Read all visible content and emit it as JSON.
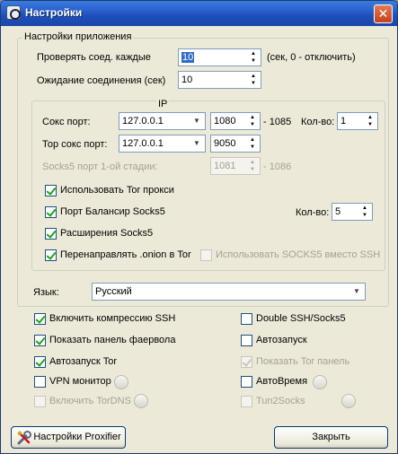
{
  "window": {
    "title": "Настройки"
  },
  "app_group": {
    "legend": "Настройки приложения"
  },
  "check_conn": {
    "label": "Проверять соед. каждые",
    "value": "10",
    "hint": "(сек, 0 - отключить)"
  },
  "wait_conn": {
    "label": "Ожидание соединения (сек)",
    "value": "10"
  },
  "ip_group": {
    "legend": "IP",
    "socks_port": {
      "label": "Сокс порт:",
      "ip": "127.0.0.1",
      "port": "1080",
      "range": "- 1085",
      "count_label": "Кол-во:",
      "count": "1"
    },
    "tor_port": {
      "label": "Тор сокс порт:",
      "ip": "127.0.0.1",
      "port": "9050"
    },
    "socks5_stage": {
      "label": "Socks5 порт 1-ой стадии:",
      "port": "1081",
      "range": "- 1086"
    },
    "use_tor": {
      "label": "Использовать Tor прокси",
      "checked": true
    },
    "port_balancer": {
      "label": "Порт Балансир Socks5",
      "checked": true,
      "count_label": "Кол-во:",
      "count": "5"
    },
    "socks5_ext": {
      "label": "Расширения Socks5",
      "checked": true
    },
    "redirect_onion": {
      "label": "Перенаправлять .onion в Tor",
      "checked": true
    },
    "use_socks5_ssh": {
      "label": "Использовать SOCKS5 вместо SSH",
      "checked": false
    }
  },
  "language": {
    "label": "Язык:",
    "value": "Русский"
  },
  "options_left": [
    {
      "label": "Включить компрессию SSH",
      "checked": true,
      "disabled": false
    },
    {
      "label": "Показать панель фаервола",
      "checked": true,
      "disabled": false
    },
    {
      "label": "Автозапуск Tor",
      "checked": true,
      "disabled": false
    },
    {
      "label": "VPN монитор",
      "checked": false,
      "disabled": false
    },
    {
      "label": "Включить TorDNS",
      "checked": false,
      "disabled": true
    }
  ],
  "options_right": [
    {
      "label": "Double SSH/Socks5",
      "checked": false,
      "disabled": false
    },
    {
      "label": "Автозапуск",
      "checked": false,
      "disabled": false
    },
    {
      "label": "Показать Tor панель",
      "checked": true,
      "disabled": true
    },
    {
      "label": "АвтоВремя",
      "checked": false,
      "disabled": false
    },
    {
      "label": "Tun2Socks",
      "checked": false,
      "disabled": true
    }
  ],
  "footer": {
    "proxifier_label": "Настройки Proxifier",
    "close_label": "Закрыть"
  }
}
